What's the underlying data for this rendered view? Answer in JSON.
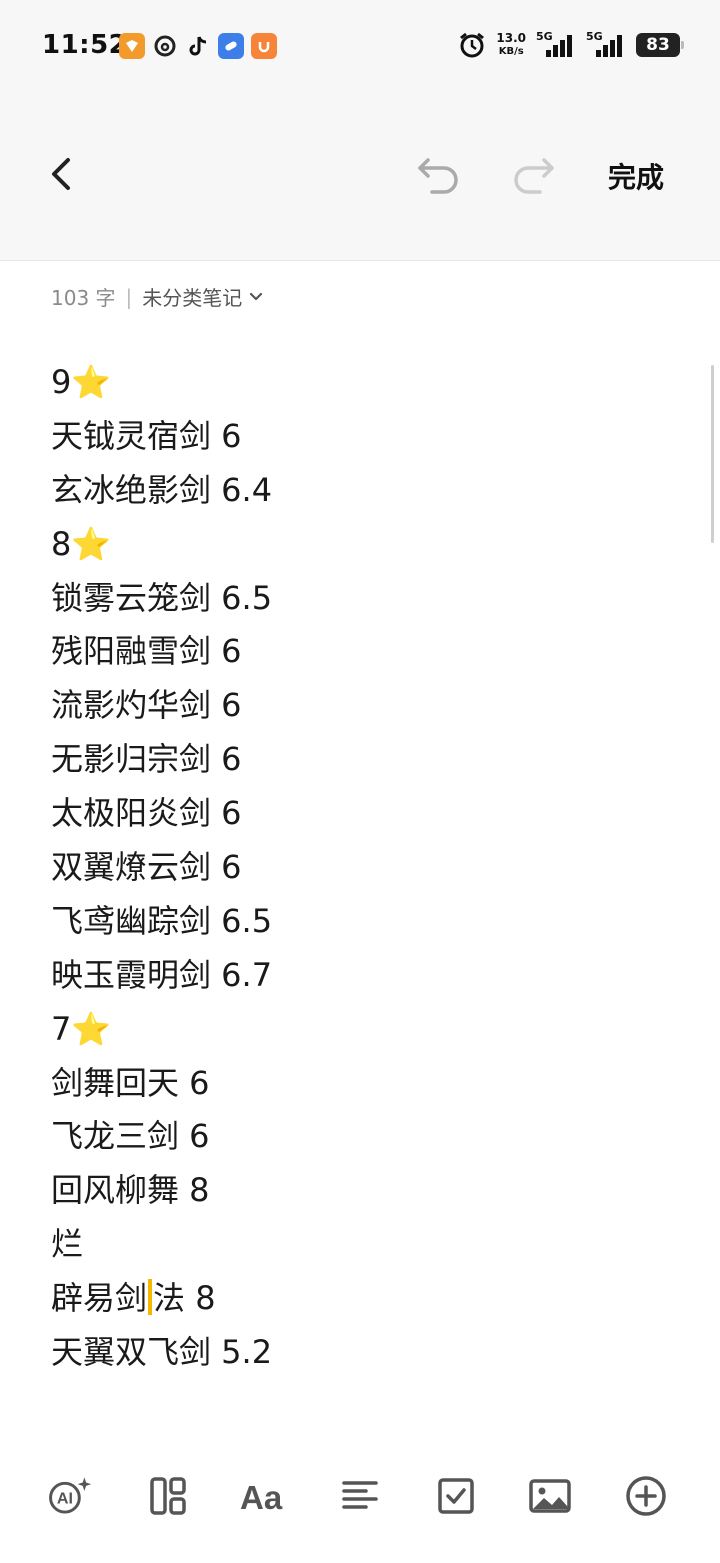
{
  "status_bar": {
    "time": "11:52",
    "net_speed_value": "13.0",
    "net_speed_unit": "KB/s",
    "sim1_label": "5G",
    "sim2_label": "5G",
    "battery": "83"
  },
  "nav": {
    "done_label": "完成"
  },
  "meta": {
    "word_count": "103 字",
    "separator": "|",
    "category": "未分类笔记"
  },
  "note": {
    "lines": [
      "9⭐",
      "天钺灵宿剑 6",
      "玄冰绝影剑 6.4",
      "8⭐",
      "锁雾云笼剑 6.5",
      "残阳融雪剑 6",
      "流影灼华剑 6",
      "无影归宗剑 6",
      "太极阳炎剑 6",
      "双翼燎云剑 6",
      "飞鸢幽踪剑 6.5",
      "映玉霞明剑 6.7",
      "7⭐",
      "剑舞回天 6",
      "飞龙三剑 6",
      "回风柳舞 8",
      "烂"
    ],
    "cursor_line_before": "辟易剑",
    "cursor_line_after": "法 8",
    "last_line": "天翼双飞剑 5.2"
  },
  "colors": {
    "cursor": "#f5b800",
    "toolbar_icon": "#555555"
  }
}
